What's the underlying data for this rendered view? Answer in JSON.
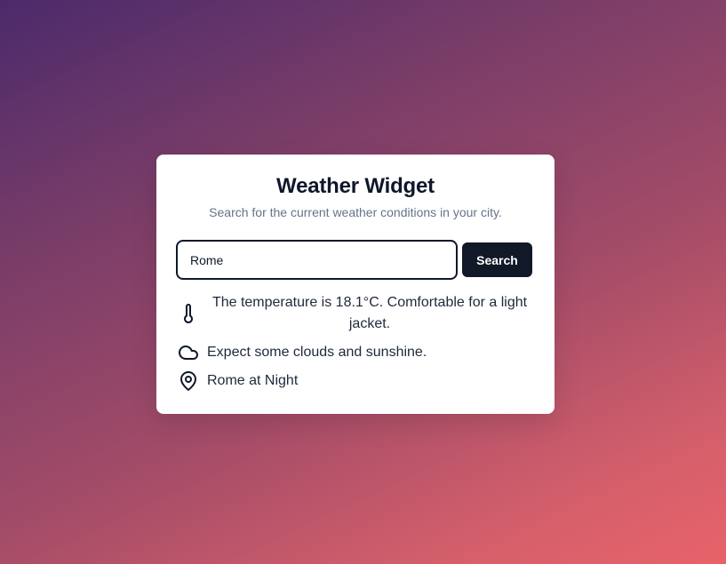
{
  "widget": {
    "title": "Weather Widget",
    "subtitle": "Search for the current weather conditions in your city.",
    "search": {
      "value": "Rome",
      "placeholder": "",
      "button_label": "Search"
    },
    "results": {
      "temperature": {
        "icon": "thermometer-icon",
        "text": "The temperature is 18.1°C. Comfortable for a light jacket."
      },
      "conditions": {
        "icon": "cloud-icon",
        "text": "Expect some clouds and sunshine."
      },
      "location": {
        "icon": "map-pin-icon",
        "text": "Rome at Night"
      }
    }
  },
  "colors": {
    "background_start": "#4b2a6b",
    "background_end": "#e8636a",
    "button": "#111827",
    "title": "#0f172a",
    "subtitle": "#64748b"
  }
}
